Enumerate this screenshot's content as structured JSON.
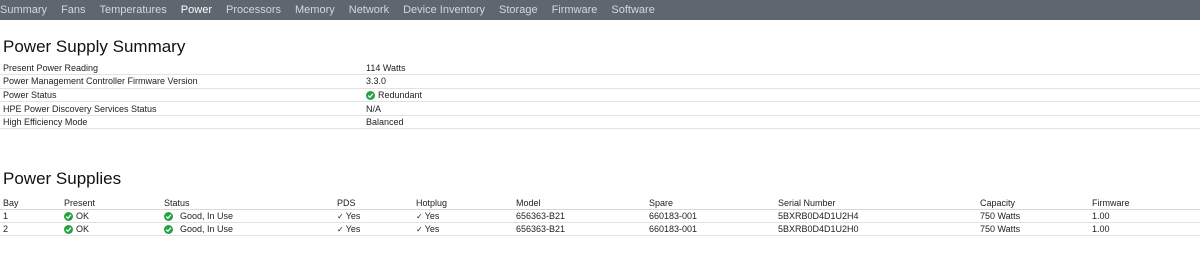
{
  "nav": {
    "tabs": [
      "Summary",
      "Fans",
      "Temperatures",
      "Power",
      "Processors",
      "Memory",
      "Network",
      "Device Inventory",
      "Storage",
      "Firmware",
      "Software"
    ],
    "active": "Power"
  },
  "summary": {
    "title": "Power Supply Summary",
    "rows": [
      {
        "label": "Present Power Reading",
        "value": "114 Watts",
        "status_icon": ""
      },
      {
        "label": "Power Management Controller Firmware Version",
        "value": "3.3.0",
        "status_icon": ""
      },
      {
        "label": "Power Status",
        "value": "Redundant",
        "status_icon": "ok-check-icon"
      },
      {
        "label": "HPE Power Discovery Services Status",
        "value": "N/A",
        "status_icon": ""
      },
      {
        "label": "High Efficiency Mode",
        "value": "Balanced",
        "status_icon": ""
      }
    ]
  },
  "supplies": {
    "title": "Power Supplies",
    "columns": [
      "Bay",
      "Present",
      "Status",
      "PDS",
      "Hotplug",
      "Model",
      "Spare",
      "Serial Number",
      "Capacity",
      "Firmware"
    ],
    "rows": [
      {
        "bay": "1",
        "present": "OK",
        "status": "Good, In Use",
        "pds": "Yes",
        "hotplug": "Yes",
        "model": "656363-B21",
        "spare": "660183-001",
        "serial": "5BXRB0D4D1U2H4",
        "capacity": "750 Watts",
        "firmware": "1.00"
      },
      {
        "bay": "2",
        "present": "OK",
        "status": "Good, In Use",
        "pds": "Yes",
        "hotplug": "Yes",
        "model": "656363-B21",
        "spare": "660183-001",
        "serial": "5BXRB0D4D1U2H0",
        "capacity": "750 Watts",
        "firmware": "1.00"
      }
    ]
  },
  "colors": {
    "nav_bg": "#5e6770",
    "ok_green": "#27a243"
  }
}
